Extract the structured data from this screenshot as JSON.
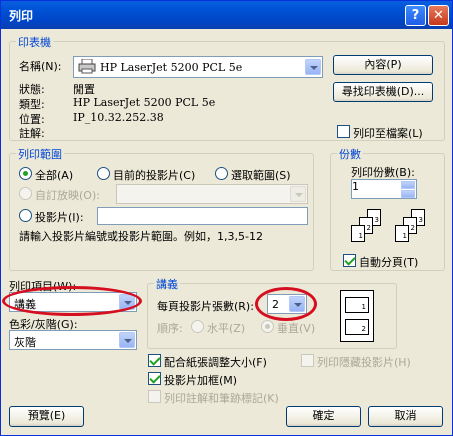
{
  "window": {
    "title": "列印",
    "help_label": "?",
    "close_label": "✕"
  },
  "printer": {
    "group_label": "印表機",
    "name_label": "名稱(N):",
    "name_value": "HP LaserJet 5200 PCL 5e",
    "status_label": "狀態:",
    "status_value": "閒置",
    "type_label": "類型:",
    "type_value": "HP LaserJet 5200 PCL 5e",
    "location_label": "位置:",
    "location_value": "IP_10.32.252.38",
    "comment_label": "註解:",
    "properties_button": "內容(P)",
    "find_printer_button": "尋找印表機(D)...",
    "print_to_file_label": "列印至檔案(L)",
    "print_to_file_checked": false
  },
  "range": {
    "group_label": "列印範圍",
    "all_label": "全部(A)",
    "current_slide_label": "目前的投影片(C)",
    "selection_label": "選取範圍(S)",
    "custom_show_label": "自訂放映(O):",
    "slides_label": "投影片(I):",
    "slides_value": "",
    "hint": "請輸入投影片編號或投影片範圍。例如，1,3,5-12",
    "selected": "all"
  },
  "copies": {
    "group_label": "份數",
    "count_label": "列印份數(B):",
    "count_value": "1",
    "collate_label": "自動分頁(T)",
    "collate_checked": true
  },
  "print_what": {
    "label": "列印項目(W):",
    "value": "講義",
    "color_label": "色彩/灰階(G):",
    "color_value": "灰階"
  },
  "handouts": {
    "group_label": "講義",
    "per_page_label": "每頁投影片張數(R):",
    "per_page_value": "2",
    "order_label": "順序:",
    "horizontal_label": "水平(Z)",
    "vertical_label": "垂直(V)",
    "order_selected": "vertical",
    "preview_pages": [
      "1",
      "2"
    ]
  },
  "options": {
    "scale_to_fit_label": "配合紙張調整大小(F)",
    "scale_to_fit_checked": true,
    "frame_slides_label": "投影片加框(M)",
    "frame_slides_checked": true,
    "comments_label": "列印註解和筆跡標記(K)",
    "hidden_slides_label": "列印隱藏投影片(H)"
  },
  "buttons": {
    "preview": "預覽(E)",
    "ok": "確定",
    "cancel": "取消"
  },
  "colors": {
    "title_bar": "#0046c8",
    "group_label": "#0046d5",
    "highlight": "#d50f1f",
    "dialog_bg": "#ece9d8"
  },
  "icons": [
    "help-icon",
    "close-icon",
    "printer-icon",
    "dropdown-arrow-icon",
    "spin-up-icon",
    "spin-down-icon"
  ]
}
